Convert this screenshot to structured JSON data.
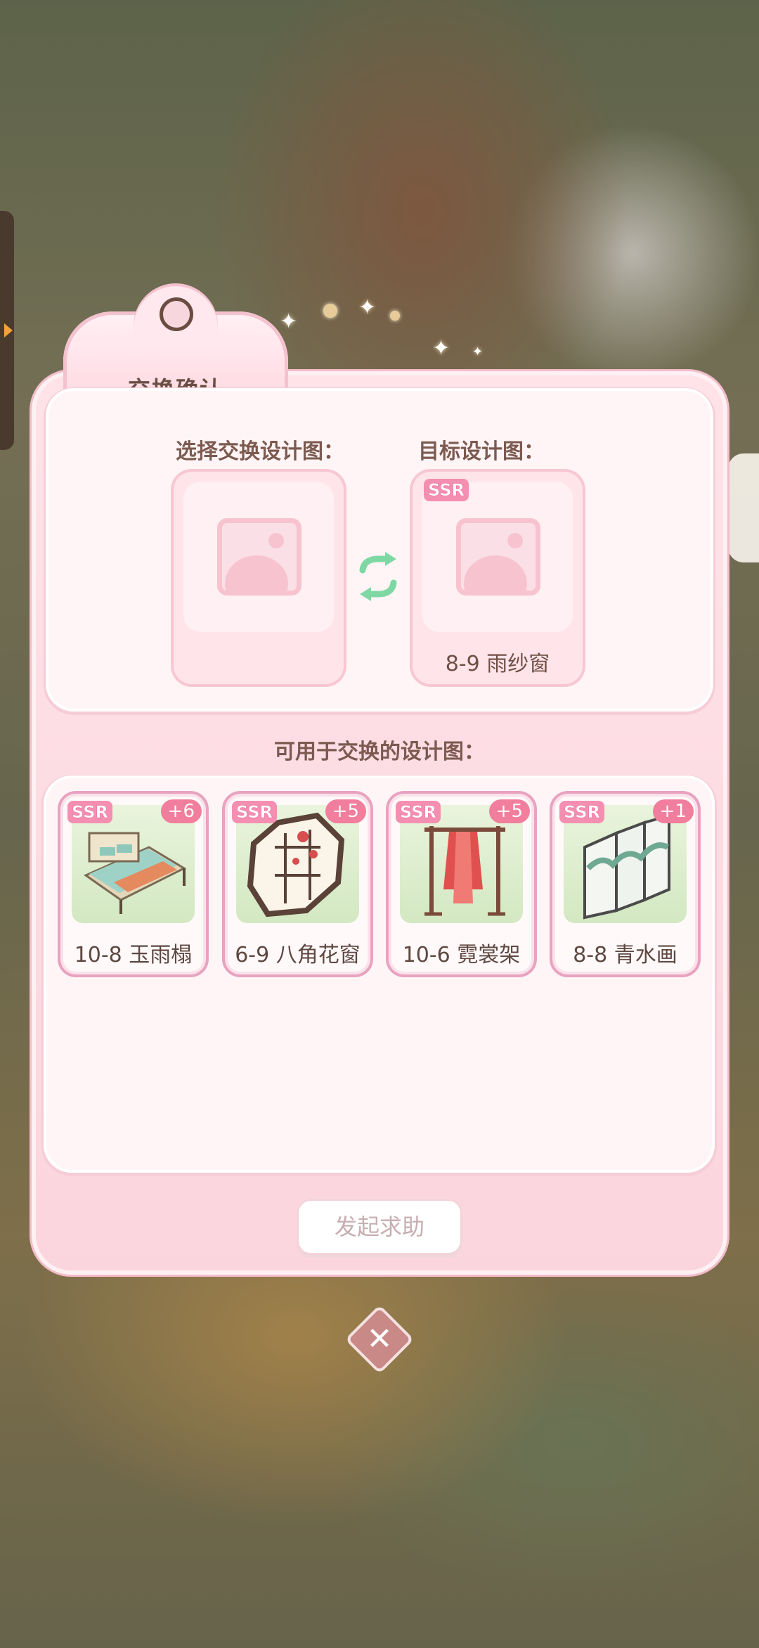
{
  "dialog": {
    "title": "交换确认",
    "select_label": "选择交换设计图：",
    "target_label": "目标设计图：",
    "target": {
      "rarity": "SSR",
      "name": "8-9 雨纱窗"
    },
    "list_label": "可用于交换的设计图：",
    "help_button": "发起求助",
    "close_symbol": "✕"
  },
  "cards": [
    {
      "rarity": "SSR",
      "count": "+6",
      "name": "10-8 玉雨榻",
      "icon": "bed-icon"
    },
    {
      "rarity": "SSR",
      "count": "+5",
      "name": "6-9 八角花窗",
      "icon": "octagon-window-icon"
    },
    {
      "rarity": "SSR",
      "count": "+5",
      "name": "10-6 霓裳架",
      "icon": "clothes-rack-icon"
    },
    {
      "rarity": "SSR",
      "count": "+1",
      "name": "8-8 青水画",
      "icon": "screen-painting-icon"
    }
  ],
  "colors": {
    "accent_pink": "#f07e9c",
    "panel": "#fff5f6",
    "swap_green": "#7fd8a4"
  }
}
